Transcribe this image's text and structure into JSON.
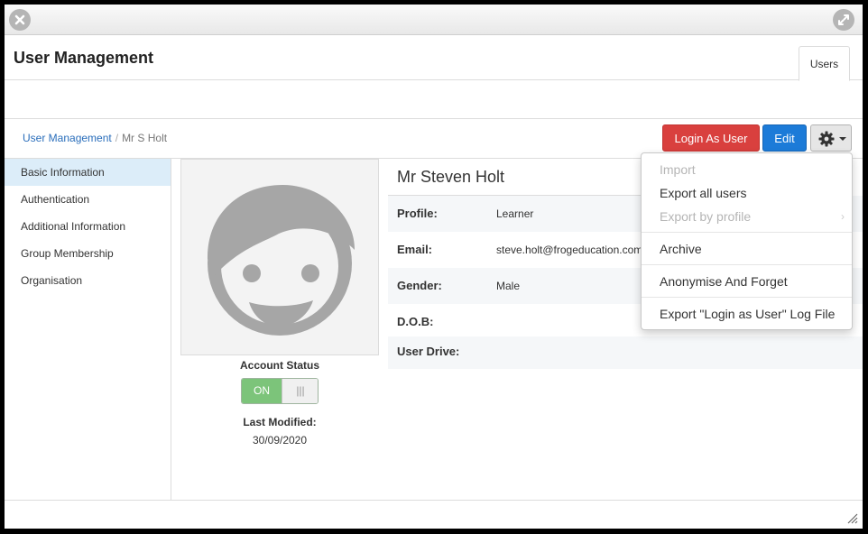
{
  "header": {
    "title": "User Management",
    "tab_users": "Users"
  },
  "breadcrumb": {
    "root": "User Management",
    "separator": "/",
    "current": "Mr S Holt"
  },
  "toolbar": {
    "login_as_user": "Login As User",
    "edit": "Edit"
  },
  "sidebar": {
    "items": [
      {
        "label": "Basic Information",
        "active": true
      },
      {
        "label": "Authentication"
      },
      {
        "label": "Additional Information"
      },
      {
        "label": "Group Membership"
      },
      {
        "label": "Organisation"
      }
    ]
  },
  "profile": {
    "name": "Mr Steven Holt",
    "account_status_label": "Account Status",
    "toggle_on": "ON",
    "toggle_handle": "|||",
    "last_modified_label": "Last Modified:",
    "last_modified_value": "30/09/2020",
    "fields": [
      {
        "key": "Profile:",
        "value": "Learner"
      },
      {
        "key": "Email:",
        "value": "steve.holt@frogeducation.com"
      },
      {
        "key": "Gender:",
        "value": "Male"
      },
      {
        "key": "D.O.B:",
        "value": ""
      },
      {
        "key": "User Drive:",
        "value": ""
      }
    ]
  },
  "dropdown": {
    "items": [
      {
        "label": "Import",
        "disabled": true
      },
      {
        "label": "Export all users"
      },
      {
        "label": "Export by profile",
        "disabled": true,
        "submenu_arrow": "›"
      },
      {
        "label": "Archive"
      },
      {
        "label": "Anonymise And Forget"
      },
      {
        "label": "Export \"Login as User\" Log File"
      }
    ]
  },
  "colors": {
    "login_button": "#d9403e",
    "edit_button": "#1c7bd8",
    "active_sidebar": "#dcedf9",
    "toggle_on": "#7cc47a",
    "link": "#2a6ebb"
  },
  "icons": {
    "close": "close-icon",
    "expand": "expand-icon",
    "gear": "gear-icon",
    "avatar": "avatar-icon",
    "resize": "resize-grip-icon"
  }
}
